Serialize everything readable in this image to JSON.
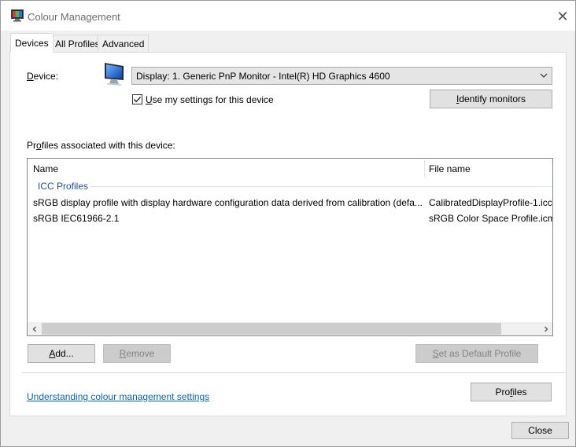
{
  "window": {
    "title": "Colour Management",
    "close_glyph": "✕"
  },
  "tabs": [
    {
      "label": "Devices",
      "active": true
    },
    {
      "label": "All Profiles",
      "active": false
    },
    {
      "label": "Advanced",
      "active": false
    }
  ],
  "device": {
    "label_accel": "D",
    "label_rest": "evice:",
    "selected": "Display: 1. Generic PnP Monitor - Intel(R) HD Graphics 4600",
    "use_settings_accel": "U",
    "use_settings_rest": "se my settings for this device",
    "use_settings_checked": true,
    "identify_accel": "I",
    "identify_rest": "dentify monitors"
  },
  "profiles": {
    "label_pre": "Pr",
    "label_accel": "o",
    "label_rest": "files associated with this device:",
    "columns": {
      "name": "Name",
      "file": "File name"
    },
    "group_title": "ICC Profiles",
    "rows": [
      {
        "name": "sRGB display profile with display hardware configuration data derived from calibration (defa...",
        "file": "CalibratedDisplayProfile-1.icc"
      },
      {
        "name": "sRGB IEC61966-2.1",
        "file": "sRGB Color Space Profile.icm"
      }
    ]
  },
  "buttons": {
    "add_accel": "A",
    "add_rest": "dd...",
    "remove_accel": "R",
    "remove_rest": "emove",
    "default_accel": "S",
    "default_rest": "et as Default Profile",
    "profiles_pre": "Pro",
    "profiles_accel": "f",
    "profiles_rest": "iles",
    "close": "Close"
  },
  "link": "Understanding colour management settings",
  "colors": {
    "accent": "#0078d7",
    "link": "#0066cc",
    "group": "#1e4e99"
  }
}
